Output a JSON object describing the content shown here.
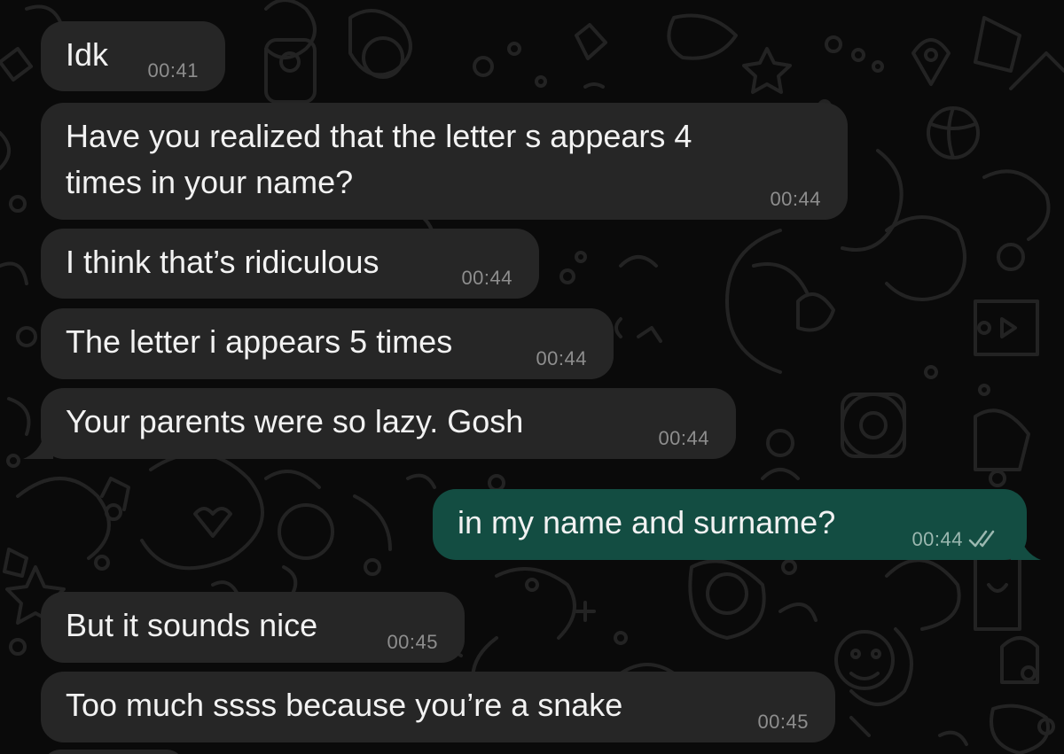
{
  "theme": {
    "incoming_bubble": "#262626",
    "outgoing_bubble": "#134d42",
    "text": "#f2f2f2",
    "time": "#8e8e8e",
    "read_receipt": "double-check-icon"
  },
  "messages": [
    {
      "id": "m1",
      "direction": "incoming",
      "text": "Idk",
      "time": "00:41"
    },
    {
      "id": "m2",
      "direction": "incoming",
      "text": "Have you realized that the letter s appears 4\ntimes in your name?",
      "time": "00:44"
    },
    {
      "id": "m3",
      "direction": "incoming",
      "text": "I think that’s ridiculous",
      "time": "00:44"
    },
    {
      "id": "m4",
      "direction": "incoming",
      "text": "The letter i appears 5 times",
      "time": "00:44"
    },
    {
      "id": "m5",
      "direction": "incoming",
      "text": "Your parents were so lazy. Gosh",
      "time": "00:44"
    },
    {
      "id": "m6",
      "direction": "outgoing",
      "text": "in my name and surname?",
      "time": "00:44",
      "status": "read"
    },
    {
      "id": "m7",
      "direction": "incoming",
      "text": "But it sounds nice",
      "time": "00:45"
    },
    {
      "id": "m8",
      "direction": "incoming",
      "text": "Too much ssss because you’re a snake",
      "time": "00:45"
    }
  ]
}
